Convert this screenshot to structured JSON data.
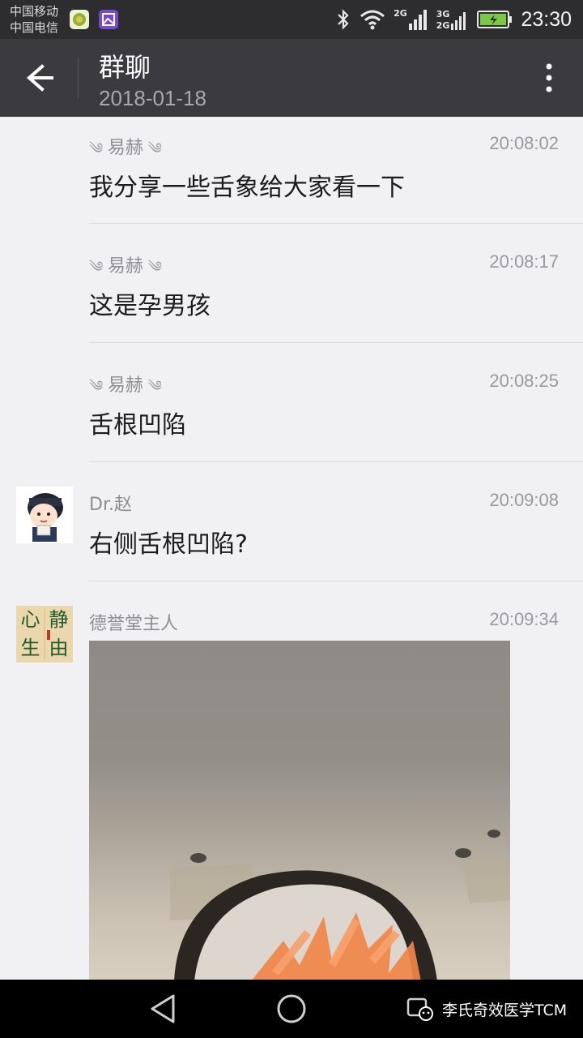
{
  "status_bar": {
    "carrier_1": "中国移动",
    "carrier_2": "中国电信",
    "network_1": "2G",
    "network_2a": "3G",
    "network_2b": "2G",
    "time": "23:30",
    "icons": [
      "bluetooth-icon",
      "wifi-icon",
      "signal-icon",
      "battery-icon"
    ]
  },
  "header": {
    "title": "群聊",
    "date": "2018-01-18"
  },
  "messages": [
    {
      "sender": "易赫",
      "time": "20:08:02",
      "text": "我分享一些舌象给大家看一下"
    },
    {
      "sender": "易赫",
      "time": "20:08:17",
      "text": "这是孕男孩"
    },
    {
      "sender": "易赫",
      "time": "20:08:25",
      "text": "舌根凹陷"
    },
    {
      "sender": "Dr.赵",
      "time": "20:09:08",
      "text": "右侧舌根凹陷?"
    },
    {
      "sender": "德誉堂主人",
      "time": "20:09:34",
      "text": ""
    }
  ],
  "avatar_calligraphy": [
    "静",
    "由",
    "心",
    "生"
  ],
  "watermark": "李氏奇效医学TCM",
  "colors": {
    "status_bar": "#2d2d30",
    "title_bar": "#3b3b3f",
    "background": "#f1f1f3",
    "battery_green": "#7ac943"
  }
}
